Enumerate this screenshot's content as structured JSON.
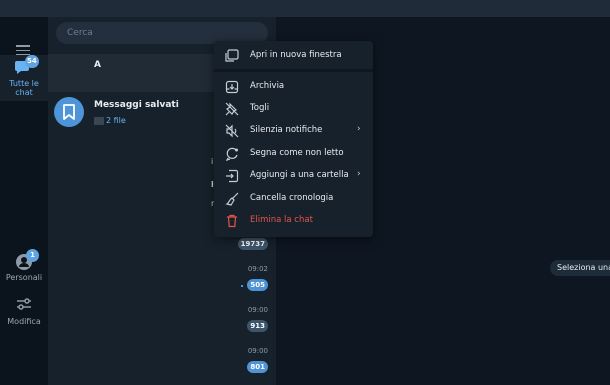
{
  "search": {
    "placeholder": "Cerca"
  },
  "folders": {
    "all": {
      "label_line1": "Tutte le",
      "label_line2": "chat",
      "badge": "54"
    },
    "personal": {
      "label": "Personali",
      "badge": "1"
    },
    "edit": {
      "label": "Modifica"
    }
  },
  "chats": {
    "pinned": {
      "name": "A"
    },
    "saved": {
      "name": "Messaggi salvati",
      "preview": "2 file"
    },
    "frag1": "i",
    "frag2": "l",
    "frag3": "r",
    "counters": [
      {
        "value": "19737",
        "time": ""
      },
      {
        "value": "505",
        "time": "09:02"
      },
      {
        "value": "913",
        "time": "09:00"
      },
      {
        "value": "801",
        "time": "09:00"
      }
    ]
  },
  "main": {
    "empty_hint": "Seleziona una chat"
  },
  "context_menu": {
    "items": [
      {
        "label": "Apri in nuova finestra",
        "icon": "new-window-icon"
      },
      {
        "label": "Archivia",
        "icon": "archive-icon"
      },
      {
        "label": "Togli",
        "icon": "unpin-icon"
      },
      {
        "label": "Silenzia notifiche",
        "icon": "mute-icon",
        "submenu": true
      },
      {
        "label": "Segna come non letto",
        "icon": "mark-unread-icon"
      },
      {
        "label": "Aggiungi a una cartella",
        "icon": "add-folder-icon",
        "submenu": true
      },
      {
        "label": "Cancella cronologia",
        "icon": "broom-icon"
      },
      {
        "label": "Elimina la chat",
        "icon": "trash-icon",
        "danger": true
      }
    ]
  },
  "colors": {
    "accent": "#5fa3e0",
    "danger": "#e5534b",
    "background": "#0e1621",
    "panel": "#17212b"
  }
}
